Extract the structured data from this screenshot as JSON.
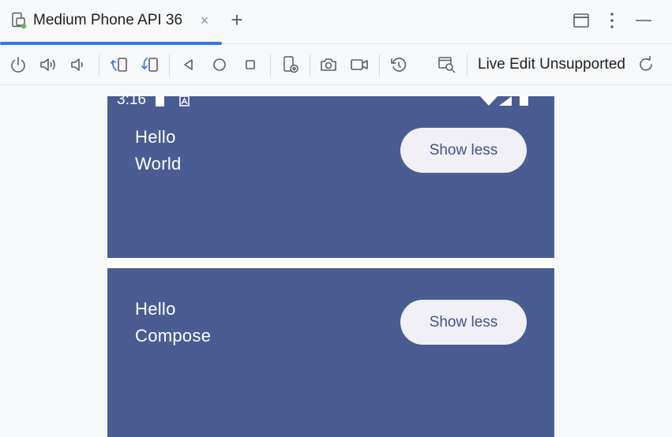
{
  "tab": {
    "title": "Medium Phone API 36",
    "close_glyph": "×",
    "add_glyph": "+"
  },
  "toolbar": {
    "icons": [
      "power-icon",
      "volume-up-icon",
      "volume-down-icon",
      "rotate-left-icon",
      "rotate-right-icon",
      "back-icon",
      "home-icon",
      "overview-icon",
      "device-settings-icon",
      "camera-icon",
      "screen-record-icon",
      "snapshot-restore-icon",
      "layout-inspector-icon",
      "refresh-icon"
    ],
    "live_edit_label": "Live Edit Unsupported"
  },
  "emulator": {
    "status_time": "3:16",
    "cards": [
      {
        "line1": "Hello",
        "line2": "World",
        "button": "Show less"
      },
      {
        "line1": "Hello",
        "line2": "Compose",
        "button": "Show less"
      }
    ]
  },
  "colors": {
    "accent": "#3574f0",
    "card": "#495d92",
    "button_bg": "#f2f0f7",
    "button_text": "#3f5488"
  }
}
